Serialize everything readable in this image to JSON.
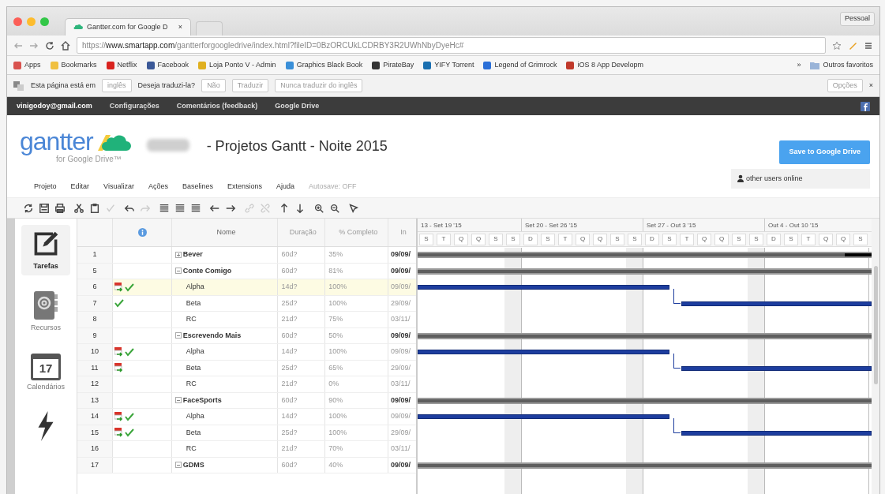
{
  "browser": {
    "tab_title": "Gantter.com for Google D",
    "tab_close": "×",
    "profile": "Pessoal",
    "url": "https://**www.smartapp.com**/gantterforgoogledrive/index.html?fileID=0BzORCUkLCDRBY3R2UWhNbyDyeHc#",
    "bookmarks": [
      {
        "label": "Apps",
        "color": "#d9534f"
      },
      {
        "label": "Bookmarks",
        "color": "#f0c040"
      },
      {
        "label": "Netflix",
        "color": "#d9231f"
      },
      {
        "label": "Facebook",
        "color": "#3b5998"
      },
      {
        "label": "Loja Ponto V - Admin",
        "color": "#e0b020"
      },
      {
        "label": "Graphics Black Book",
        "color": "#3a8fd8"
      },
      {
        "label": "PirateBay",
        "color": "#333333"
      },
      {
        "label": "YIFY Torrent",
        "color": "#1a6fb0"
      },
      {
        "label": "Legend of Grimrock",
        "color": "#2a6fd8"
      },
      {
        "label": "iOS 8 App Developm",
        "color": "#c0392b"
      }
    ],
    "more": "»",
    "other_bookmarks": "Outros favoritos"
  },
  "translate_bar": {
    "prefix": "Esta página está em",
    "language": "inglês",
    "question": "Deseja traduzi-la?",
    "buttons": [
      "Não",
      "Traduzir",
      "Nunca traduzir do inglês"
    ],
    "options": "Opções",
    "close": "×"
  },
  "account_bar": {
    "items": [
      "vinigodoy@gmail.com",
      "Configurações",
      "Comentários (feedback)",
      "Google Drive"
    ]
  },
  "app": {
    "logo": "gantter",
    "logo_sub": "for Google Drive™",
    "title": "- Projetos Gantt - Noite 2015",
    "save_button": "Save to Google Drive",
    "online": "other users online",
    "menu": [
      "Projeto",
      "Editar",
      "Visualizar",
      "Ações",
      "Baselines",
      "Extensions",
      "Ajuda"
    ],
    "autosave": "Autosave: OFF"
  },
  "toolbar": [
    [
      {
        "kind": "refresh",
        "disabled": false
      },
      {
        "kind": "save",
        "disabled": false
      },
      {
        "kind": "print",
        "disabled": false
      }
    ],
    [
      {
        "kind": "cut",
        "disabled": false
      },
      {
        "kind": "paste",
        "disabled": false
      },
      {
        "kind": "check",
        "disabled": true
      }
    ],
    [
      {
        "kind": "undo",
        "disabled": false
      },
      {
        "kind": "redo",
        "disabled": true
      }
    ],
    [
      {
        "kind": "list",
        "disabled": false
      },
      {
        "kind": "list",
        "disabled": false
      },
      {
        "kind": "list",
        "disabled": false
      }
    ],
    [
      {
        "kind": "left",
        "disabled": false
      },
      {
        "kind": "right",
        "disabled": false
      }
    ],
    [
      {
        "kind": "link",
        "disabled": true
      },
      {
        "kind": "unlink",
        "disabled": true
      }
    ],
    [
      {
        "kind": "up",
        "disabled": false
      },
      {
        "kind": "down",
        "disabled": false
      }
    ],
    [
      {
        "kind": "zoom-in",
        "disabled": false
      },
      {
        "kind": "zoom-out",
        "disabled": false
      }
    ],
    [
      {
        "kind": "pointer",
        "disabled": false
      }
    ]
  ],
  "sidebar": [
    {
      "kind": "tasks",
      "label": "Tarefas",
      "selected": true
    },
    {
      "kind": "resources",
      "label": "Recursos",
      "selected": false
    },
    {
      "kind": "calendars",
      "label": "Calendários",
      "selected": false,
      "badge": "17"
    },
    {
      "kind": "actions",
      "selected": false
    }
  ],
  "grid": {
    "columns": [
      "Nome",
      "Duração",
      "% Completo",
      "In"
    ],
    "rows": [
      {
        "id": "1",
        "name": "Bever",
        "summary": true,
        "expanded": false,
        "duration": "60d?",
        "complete": "35%",
        "start": "09/09/",
        "indicators": [],
        "selected": false,
        "bar": {
          "kind": "summary-overdue"
        }
      },
      {
        "id": "5",
        "name": "Conte Comigo",
        "summary": true,
        "expanded": true,
        "duration": "60d?",
        "complete": "81%",
        "start": "09/09/",
        "indicators": [],
        "selected": false,
        "bar": {
          "kind": "summary"
        }
      },
      {
        "id": "6",
        "name": "Alpha",
        "summary": false,
        "duration": "14d?",
        "complete": "100%",
        "start": "09/09/",
        "indicators": [
          {
            "kind": "constraint"
          },
          {
            "kind": "done"
          }
        ],
        "selected": true,
        "bar": {
          "kind": "phase-1"
        }
      },
      {
        "id": "7",
        "name": "Beta",
        "summary": false,
        "duration": "25d?",
        "complete": "100%",
        "start": "29/09/",
        "indicators": [
          {
            "kind": "done"
          }
        ],
        "selected": false,
        "bar": {
          "kind": "phase-2"
        }
      },
      {
        "id": "8",
        "name": "RC",
        "summary": false,
        "duration": "21d?",
        "complete": "75%",
        "start": "03/11/",
        "indicators": [],
        "selected": false
      },
      {
        "id": "9",
        "name": "Escrevendo Mais",
        "summary": true,
        "expanded": true,
        "duration": "60d?",
        "complete": "50%",
        "start": "09/09/",
        "indicators": [],
        "selected": false,
        "bar": {
          "kind": "summary"
        }
      },
      {
        "id": "10",
        "name": "Alpha",
        "summary": false,
        "duration": "14d?",
        "complete": "100%",
        "start": "09/09/",
        "indicators": [
          {
            "kind": "constraint"
          },
          {
            "kind": "done"
          }
        ],
        "selected": false,
        "bar": {
          "kind": "phase-1"
        }
      },
      {
        "id": "11",
        "name": "Beta",
        "summary": false,
        "duration": "25d?",
        "complete": "65%",
        "start": "29/09/",
        "indicators": [
          {
            "kind": "constraint"
          }
        ],
        "selected": false,
        "bar": {
          "kind": "phase-2"
        }
      },
      {
        "id": "12",
        "name": "RC",
        "summary": false,
        "duration": "21d?",
        "complete": "0%",
        "start": "03/11/",
        "indicators": [],
        "selected": false
      },
      {
        "id": "13",
        "name": "FaceSports",
        "summary": true,
        "expanded": true,
        "duration": "60d?",
        "complete": "90%",
        "start": "09/09/",
        "indicators": [],
        "selected": false,
        "bar": {
          "kind": "summary"
        }
      },
      {
        "id": "14",
        "name": "Alpha",
        "summary": false,
        "duration": "14d?",
        "complete": "100%",
        "start": "09/09/",
        "indicators": [
          {
            "kind": "constraint"
          },
          {
            "kind": "done"
          }
        ],
        "selected": false,
        "bar": {
          "kind": "phase-1"
        }
      },
      {
        "id": "15",
        "name": "Beta",
        "summary": false,
        "duration": "25d?",
        "complete": "100%",
        "start": "29/09/",
        "indicators": [
          {
            "kind": "constraint"
          },
          {
            "kind": "done"
          }
        ],
        "selected": false,
        "bar": {
          "kind": "phase-2"
        }
      },
      {
        "id": "16",
        "name": "RC",
        "summary": false,
        "duration": "21d?",
        "complete": "70%",
        "start": "03/11/",
        "indicators": [],
        "selected": false
      },
      {
        "id": "17",
        "name": "GDMS",
        "summary": true,
        "expanded": true,
        "duration": "60d?",
        "complete": "40%",
        "start": "09/09/",
        "indicators": [],
        "selected": false,
        "bar": {
          "kind": "summary"
        }
      }
    ]
  },
  "gantt": {
    "weeks": [
      {
        "label": "13 - Set 19 '15",
        "days": [
          {
            "label": "S",
            "weekend": false
          },
          {
            "label": "T",
            "weekend": false
          },
          {
            "label": "Q",
            "weekend": false
          },
          {
            "label": "Q",
            "weekend": false
          },
          {
            "label": "S",
            "weekend": false
          },
          {
            "label": "S",
            "weekend": true
          }
        ]
      },
      {
        "label": "Set 20 - Set 26 '15",
        "days": [
          {
            "label": "D",
            "weekend": false
          },
          {
            "label": "S",
            "weekend": false
          },
          {
            "label": "T",
            "weekend": false
          },
          {
            "label": "Q",
            "weekend": false
          },
          {
            "label": "Q",
            "weekend": false
          },
          {
            "label": "S",
            "weekend": false
          },
          {
            "label": "S",
            "weekend": true
          }
        ]
      },
      {
        "label": "Set 27 - Out 3 '15",
        "days": [
          {
            "label": "D",
            "weekend": false
          },
          {
            "label": "S",
            "weekend": false
          },
          {
            "label": "T",
            "weekend": false
          },
          {
            "label": "Q",
            "weekend": false
          },
          {
            "label": "Q",
            "weekend": false
          },
          {
            "label": "S",
            "weekend": false
          },
          {
            "label": "S",
            "weekend": true
          }
        ]
      },
      {
        "label": "Out 4 - Out 10 '15",
        "days": [
          {
            "label": "D",
            "weekend": false
          },
          {
            "label": "S",
            "weekend": false
          },
          {
            "label": "T",
            "weekend": false
          },
          {
            "label": "Q",
            "weekend": false
          },
          {
            "label": "Q",
            "weekend": false
          },
          {
            "label": "S",
            "weekend": false
          }
        ]
      }
    ]
  }
}
